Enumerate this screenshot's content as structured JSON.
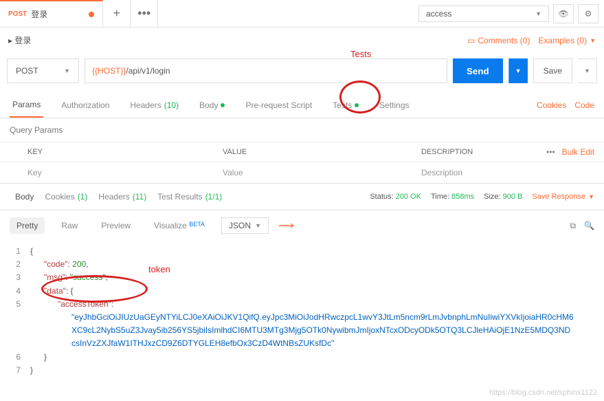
{
  "tab": {
    "method": "POST",
    "name": "登录"
  },
  "env": "access",
  "breadcrumb": "登录",
  "header_links": {
    "comments": "Comments (0)",
    "examples": "Examples (0)"
  },
  "request": {
    "method": "POST",
    "host": "{{HOST}}",
    "path": "/api/v1/login",
    "send": "Send",
    "save": "Save"
  },
  "req_tabs": {
    "params": "Params",
    "auth": "Authorization",
    "headers": "Headers",
    "headers_count": "(10)",
    "body": "Body",
    "prereq": "Pre-request Script",
    "tests": "Tests",
    "settings": "Settings",
    "cookies": "Cookies",
    "code": "Code"
  },
  "query_params": {
    "title": "Query Params",
    "key_h": "KEY",
    "value_h": "VALUE",
    "desc_h": "DESCRIPTION",
    "key_p": "Key",
    "value_p": "Value",
    "desc_p": "Description",
    "bulk": "Bulk Edit"
  },
  "resp_tabs": {
    "body": "Body",
    "cookies": "Cookies",
    "cookies_n": "(1)",
    "headers": "Headers",
    "headers_n": "(11)",
    "test_results": "Test Results",
    "test_results_n": "(1/1)"
  },
  "status": {
    "status_l": "Status:",
    "status_v": "200 OK",
    "time_l": "Time:",
    "time_v": "858ms",
    "size_l": "Size:",
    "size_v": "900 B",
    "save_resp": "Save Response"
  },
  "toolbar": {
    "pretty": "Pretty",
    "raw": "Raw",
    "preview": "Preview",
    "visualize": "Visualize",
    "beta": "BETA",
    "format": "JSON"
  },
  "json": {
    "code_k": "\"code\"",
    "code_v": "200",
    "msg_k": "\"msg\"",
    "msg_v": "\"success\"",
    "data_k": "\"data\"",
    "token_k": "\"accessToken\"",
    "token_v": "\"eyJhbGciOiJIUzUaGEyNTYiLCJ0eXAiOiJKV1QifQ.eyJpc3MiOiJodHRwczpcL1wvY3JtLm5ncm9rLmJvbnphLmNuIiwiYXVkIjoiaHR0cHM6XC9cL2NybS5uZ3Jvay5ib256YS5jbiIsImlhdCI6MTU3MTg3Mjg5OTk0NywibmJmIjoxNTcxODcyODk5OTQ3LCJleHAiOjE1NzE5MDQ3NDcsInVzZXJfaW1ITHJxzCD9Z6DTYGLEH8efbOx3CzD4WtNBsZUKsfDc\""
  },
  "annotations": {
    "tests": "Tests",
    "token": "token"
  },
  "watermark": "https://blog.csdn.net/sphinx1122"
}
